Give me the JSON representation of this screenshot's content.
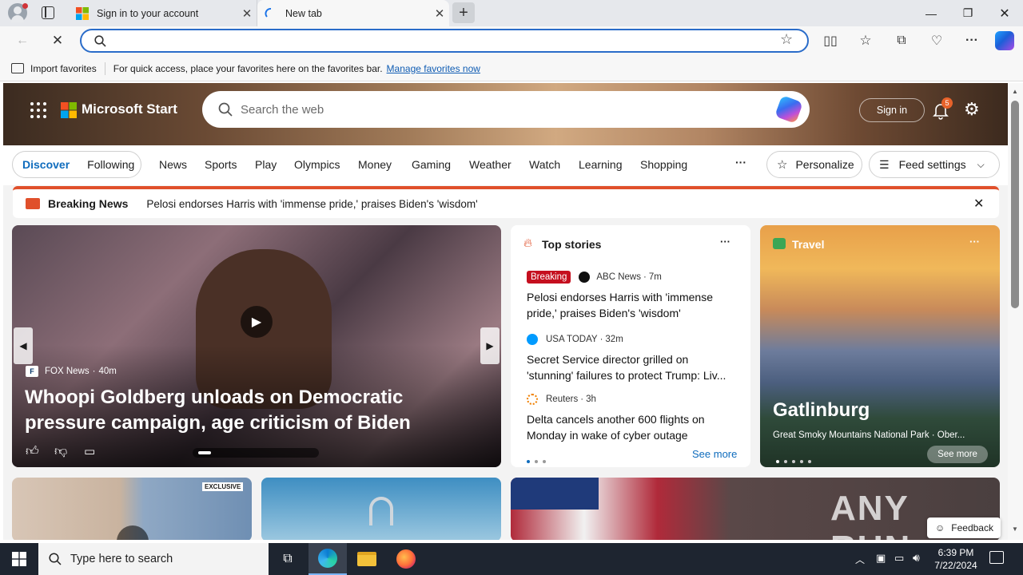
{
  "browser": {
    "tabs": [
      {
        "label": "Sign in to your account",
        "icon": "microsoft-logo-icon"
      },
      {
        "label": "New tab",
        "icon": "loading-spinner-icon"
      }
    ],
    "address_placeholder": "",
    "favorites_bar": {
      "import_label": "Import favorites",
      "hint": "For quick access, place your favorites here on the favorites bar.",
      "manage_link": "Manage favorites now"
    }
  },
  "msn": {
    "brand": "Microsoft Start",
    "search_placeholder": "Search the web",
    "signin_label": "Sign in",
    "notification_count": "5",
    "feed_tabs": [
      "Discover",
      "Following"
    ],
    "nav_links": [
      "News",
      "Sports",
      "Play",
      "Olympics",
      "Money",
      "Gaming",
      "Weather",
      "Watch",
      "Learning",
      "Shopping"
    ],
    "more_label": "···",
    "personalize_label": "Personalize",
    "feed_settings_label": "Feed settings",
    "breaking": {
      "label": "Breaking News",
      "headline": "Pelosi endorses Harris with 'immense pride,' praises Biden's 'wisdom'"
    },
    "hero_card": {
      "source": "FOX News",
      "age": "40m",
      "title": "Whoopi Goldberg unloads on Democratic pressure campaign, age criticism of Biden"
    },
    "top_stories": {
      "title": "Top stories",
      "items": [
        {
          "badge": "Breaking",
          "source": "ABC News",
          "age": "7m",
          "title": "Pelosi endorses Harris with 'immense pride,' praises Biden's 'wisdom'"
        },
        {
          "source": "USA TODAY",
          "age": "32m",
          "title": "Secret Service director grilled on 'stunning' failures to protect Trump: Liv..."
        },
        {
          "source": "Reuters",
          "age": "3h",
          "title": "Delta cancels another 600 flights on Monday in wake of cyber outage"
        }
      ],
      "see_more": "See more"
    },
    "travel": {
      "label": "Travel",
      "title": "Gatlinburg",
      "subtitle": "Great Smoky Mountains National Park · Ober...",
      "see_more": "See more"
    },
    "bottom_thumb_label": "EXCLUSIVE",
    "watermark": "ANY RUN",
    "feedback_label": "Feedback"
  },
  "taskbar": {
    "search_placeholder": "Type here to search",
    "time": "6:39 PM",
    "date": "7/22/2024"
  },
  "colors": {
    "accent": "#0f6cbd",
    "breaking_red": "#c50f1f",
    "taskbar": "#1e2530"
  }
}
